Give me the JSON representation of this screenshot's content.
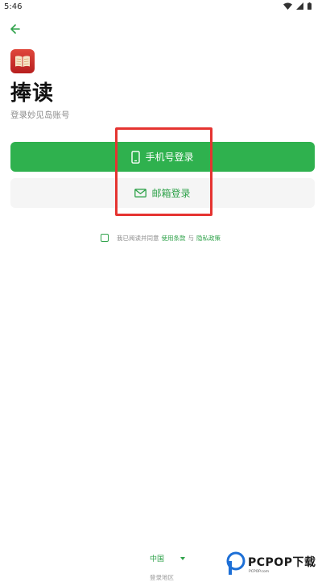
{
  "status_bar": {
    "time": "5:46",
    "icons": [
      "wifi-icon",
      "signal-icon",
      "battery-icon"
    ]
  },
  "header": {
    "back_icon": "arrow-left-icon"
  },
  "app": {
    "name": "捧读",
    "subtitle": "登录妙见岛账号",
    "logo_icon": "open-book-icon"
  },
  "login": {
    "phone_label": "手机号登录",
    "phone_icon": "smartphone-icon",
    "email_label": "邮箱登录",
    "email_icon": "envelope-icon"
  },
  "agreement": {
    "checked": false,
    "prefix": "我已阅读并同意",
    "terms_link": "使用条款",
    "conjunction": "与",
    "privacy_link": "隐私政策"
  },
  "region": {
    "selected": "中国",
    "label": "登录地区"
  },
  "watermark": {
    "text": "PCPOP下载",
    "subtext": "PCPOP.com"
  },
  "colors": {
    "accent": "#2fb14e",
    "annotation": "#e53431"
  }
}
